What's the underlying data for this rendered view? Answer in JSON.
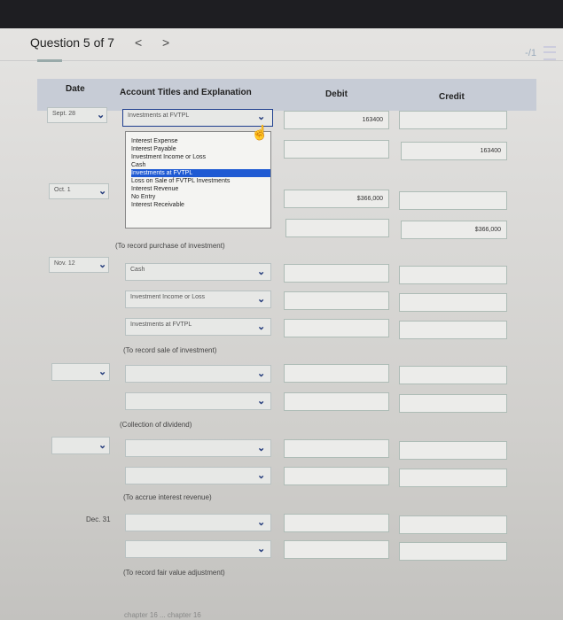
{
  "header": {
    "question": "Question 5 of 7",
    "prev": "<",
    "next": ">",
    "score": "-/1"
  },
  "table": {
    "col_date": "Date",
    "col_account": "Account Titles and Explanation",
    "col_debit": "Debit",
    "col_credit": "Credit"
  },
  "rows": [
    {
      "date": "Sept. 28",
      "account": "Investments at FVTPL",
      "debit": "163400",
      "credit": ""
    },
    {
      "date": "",
      "account": "",
      "debit": "",
      "credit": "163400"
    },
    {
      "date": "Oct. 1",
      "account": "",
      "debit": "$366,000",
      "credit": ""
    },
    {
      "date": "",
      "account": "",
      "debit": "",
      "credit": "$366,000"
    },
    {
      "date": "Nov. 12",
      "account": "Cash",
      "debit": "",
      "credit": ""
    },
    {
      "date": "",
      "account": "Investment Income or Loss",
      "debit": "",
      "credit": ""
    },
    {
      "date": "",
      "account": "Investments at FVTPL",
      "debit": "",
      "credit": ""
    },
    {
      "date": "Dec. 31",
      "account": "",
      "debit": "",
      "credit": ""
    }
  ],
  "dropdown": [
    "Interest Expense",
    "Interest Payable",
    "Investment Income or Loss",
    "Cash",
    "Investments at FVTPL",
    "Loss on Sale of FVTPL Investments",
    "Interest Revenue",
    "No Entry",
    "Interest Receivable"
  ],
  "notes": {
    "n1": "(To record purchase of investment)",
    "n2": "(To record sale of investment)",
    "n3": "(Collection of dividend)",
    "n4": "(To accrue interest revenue)",
    "n5": "(To record fair value adjustment)"
  },
  "footer": "chapter 16 ... chapter 16"
}
